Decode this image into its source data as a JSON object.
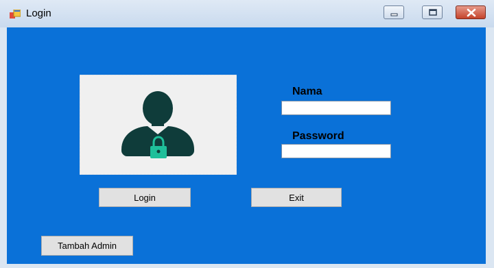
{
  "window": {
    "title": "Login",
    "accent_color": "#0a71d8"
  },
  "titlebar_buttons": {
    "minimize_icon": "minimize-icon",
    "maximize_icon": "maximize-icon",
    "close_icon": "close-icon"
  },
  "form": {
    "avatar_icon": "user-lock-icon",
    "nama_label": "Nama",
    "nama_value": "",
    "password_label": "Password",
    "password_value": ""
  },
  "buttons": {
    "login_label": "Login",
    "exit_label": "Exit",
    "tambah_admin_label": "Tambah Admin"
  }
}
